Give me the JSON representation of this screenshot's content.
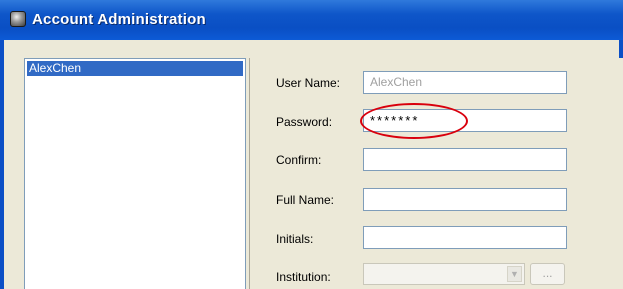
{
  "window": {
    "title": "Account Administration"
  },
  "user_list": {
    "items": [
      "AlexChen"
    ]
  },
  "form": {
    "user_name": {
      "label": "User Name:",
      "value": "AlexChen"
    },
    "password": {
      "label": "Password:",
      "value": "*******"
    },
    "confirm": {
      "label": "Confirm:",
      "value": ""
    },
    "full_name": {
      "label": "Full Name:",
      "value": ""
    },
    "initials": {
      "label": "Initials:",
      "value": ""
    },
    "institution": {
      "label": "Institution:",
      "value": "",
      "browse_label": "..."
    }
  },
  "colors": {
    "titlebar": "#0a4fc4",
    "selection": "#316ac5",
    "highlight_circle": "#d9000d",
    "panel_bg": "#ece9d8"
  },
  "icons": {
    "app": "app-icon",
    "dropdown": "chevron-down-icon"
  }
}
